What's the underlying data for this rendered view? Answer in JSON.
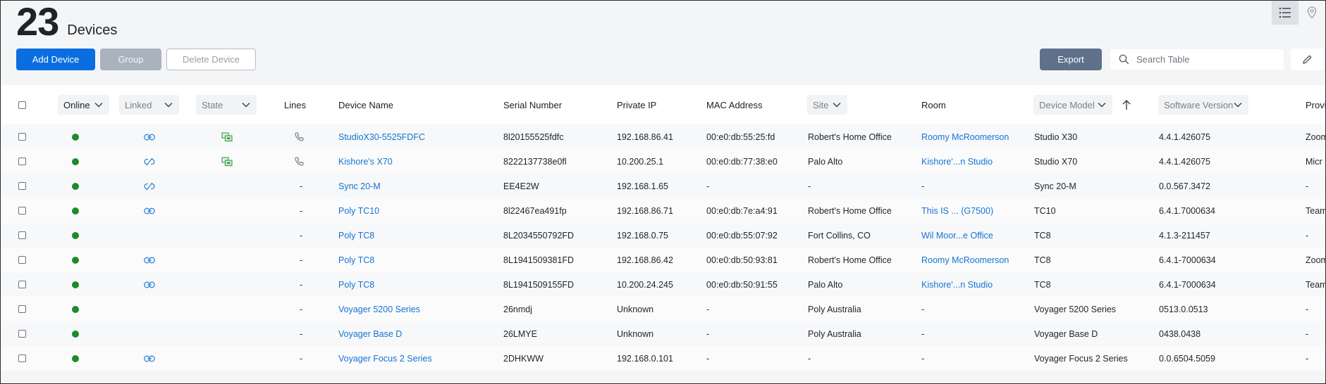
{
  "header": {
    "count": "23",
    "title": "Devices"
  },
  "toolbar": {
    "add_device": "Add Device",
    "group": "Group",
    "delete_device": "Delete Device",
    "export": "Export",
    "search_placeholder": "Search Table"
  },
  "columns": {
    "online": "Online",
    "linked": "Linked",
    "state": "State",
    "lines": "Lines",
    "device_name": "Device Name",
    "serial_number": "Serial Number",
    "private_ip": "Private IP",
    "mac_address": "MAC Address",
    "site": "Site",
    "room": "Room",
    "device_model": "Device Model",
    "software_version": "Software Version",
    "provider": "Provi"
  },
  "colors": {
    "accent": "#0a6ee0",
    "online": "#1e8a2a",
    "link": "#1574d4"
  },
  "rows": [
    {
      "linked": "link",
      "state": "state-icon",
      "lines": "phone",
      "name": "StudioX30-5525FDFC",
      "serial": "8l20155525fdfc",
      "ip": "192.168.86.41",
      "mac": "00:e0:db:55:25:fd",
      "site": "Robert's Home Office",
      "room": "Roomy McRoomerson",
      "room_link": true,
      "model": "Studio X30",
      "version": "4.4.1.426075",
      "provider": "Zoom"
    },
    {
      "linked": "unlink",
      "state": "state-icon",
      "lines": "phone",
      "name": "Kishore's X70",
      "serial": "8222137738e0fl",
      "ip": "10.200.25.1",
      "mac": "00:e0:db:77:38:e0",
      "site": "Palo Alto",
      "room": "Kishore'...n Studio",
      "room_link": true,
      "model": "Studio X70",
      "version": "4.4.1.426075",
      "provider": "Micr"
    },
    {
      "linked": "unlink",
      "state": "",
      "lines": "-",
      "name": "Sync 20-M",
      "serial": "EE4E2W",
      "ip": "192.168.1.65",
      "mac": "-",
      "site": "-",
      "room": "-",
      "room_link": false,
      "model": "Sync 20-M",
      "version": "0.0.567.3472",
      "provider": "-"
    },
    {
      "linked": "link",
      "state": "",
      "lines": "-",
      "name": "Poly TC10",
      "serial": "8l22467ea491fp",
      "ip": "192.168.86.71",
      "mac": "00:e0:db:7e:a4:91",
      "site": "Robert's Home Office",
      "room": "This IS ... (G7500)",
      "room_link": true,
      "model": "TC10",
      "version": "6.4.1.7000634",
      "provider": "Team"
    },
    {
      "linked": "",
      "state": "",
      "lines": "-",
      "name": "Poly TC8",
      "serial": "8L2034550792FD",
      "ip": "192.168.0.75",
      "mac": "00:e0:db:55:07:92",
      "site": "Fort Collins, CO",
      "room": "Wil Moor...e Office",
      "room_link": true,
      "model": "TC8",
      "version": "4.1.3-211457",
      "provider": "-"
    },
    {
      "linked": "link",
      "state": "",
      "lines": "-",
      "name": "Poly TC8",
      "serial": "8L1941509381FD",
      "ip": "192.168.86.42",
      "mac": "00:e0:db:50:93:81",
      "site": "Robert's Home Office",
      "room": "Roomy McRoomerson",
      "room_link": true,
      "model": "TC8",
      "version": "6.4.1-7000634",
      "provider": "Zoom"
    },
    {
      "linked": "link",
      "state": "",
      "lines": "-",
      "name": "Poly TC8",
      "serial": "8L1941509155FD",
      "ip": "10.200.24.245",
      "mac": "00:e0:db:50:91:55",
      "site": "Palo Alto",
      "room": "Kishore'...n Studio",
      "room_link": true,
      "model": "TC8",
      "version": "6.4.1-7000634",
      "provider": "Team"
    },
    {
      "linked": "",
      "state": "",
      "lines": "-",
      "name": "Voyager 5200 Series",
      "serial": "26nmdj",
      "ip": "Unknown",
      "mac": "-",
      "site": "Poly Australia",
      "room": "-",
      "room_link": false,
      "model": "Voyager 5200 Series",
      "version": "0513.0.0513",
      "provider": "-"
    },
    {
      "linked": "",
      "state": "",
      "lines": "-",
      "name": "Voyager Base D",
      "serial": "26LMYE",
      "ip": "Unknown",
      "mac": "-",
      "site": "Poly Australia",
      "room": "-",
      "room_link": false,
      "model": "Voyager Base D",
      "version": "0438.0438",
      "provider": "-"
    },
    {
      "linked": "link",
      "state": "",
      "lines": "-",
      "name": "Voyager Focus 2 Series",
      "serial": "2DHKWW",
      "ip": "192.168.0.101",
      "mac": "-",
      "site": "-",
      "room": "-",
      "room_link": false,
      "model": "Voyager Focus 2 Series",
      "version": "0.0.6504.5059",
      "provider": "-"
    }
  ]
}
